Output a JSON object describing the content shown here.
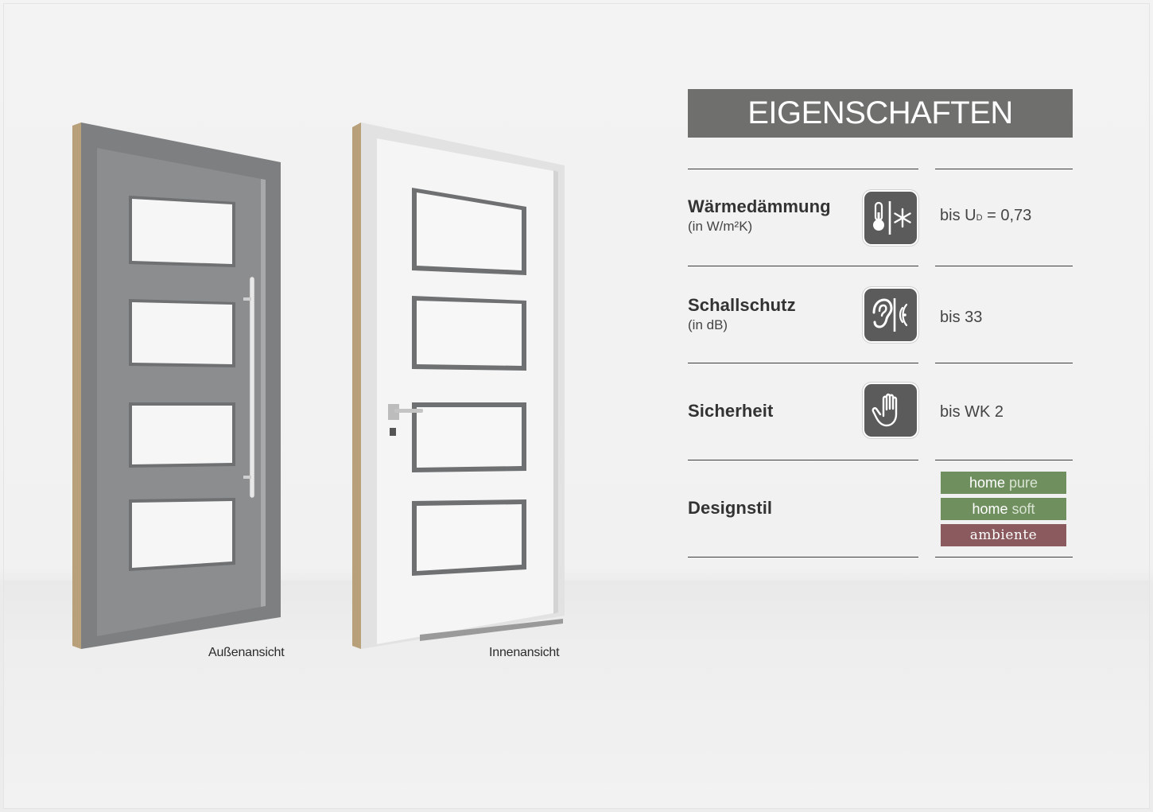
{
  "header": {
    "title": "EIGENSCHAFTEN"
  },
  "doors": {
    "outside_caption": "Außenansicht",
    "inside_caption": "Innenansicht"
  },
  "properties": [
    {
      "label": "Wärmedämmung",
      "unit": "(in W/m²K)",
      "value_prefix": "bis U",
      "value_sub": "D",
      "value_suffix": " = 0,73",
      "icon": "thermometer-snowflake-icon"
    },
    {
      "label": "Schallschutz",
      "unit": "(in dB)",
      "value": "bis 33",
      "icon": "ear-sound-waves-icon"
    },
    {
      "label": "Sicherheit",
      "value": "bis WK 2",
      "icon": "hand-stop-icon"
    },
    {
      "label": "Designstil"
    }
  ],
  "design_styles": [
    {
      "main": "home",
      "sub": "pure",
      "color": "#6f8f5f"
    },
    {
      "main": "home",
      "sub": "soft",
      "color": "#6f8f5f"
    },
    {
      "main": "ambiente",
      "color": "#8a5a5e"
    }
  ],
  "colors": {
    "header_bg": "#6f6f6d",
    "icon_bg": "#5b5b5b",
    "door_outer": "#8a8c8e",
    "door_inner": "#f4f4f4"
  }
}
